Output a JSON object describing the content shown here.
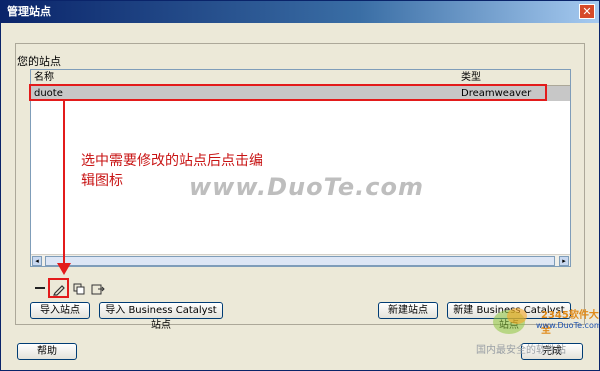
{
  "window": {
    "title": "管理站点",
    "close_glyph": "✕"
  },
  "group": {
    "title": "您的站点"
  },
  "list": {
    "headers": {
      "name": "名称",
      "type": "类型"
    },
    "rows": [
      {
        "name": "duote",
        "type": "Dreamweaver"
      }
    ]
  },
  "toolbar": {
    "remove_icon": "minus-icon",
    "edit_icon": "pencil-icon",
    "duplicate_icon": "duplicate-icon",
    "export_icon": "export-icon"
  },
  "annotation": {
    "text": "选中需要修改的站点后点击编辑图标"
  },
  "watermark": {
    "text": "www.DuoTe.com"
  },
  "buttons": {
    "import_site": "导入站点",
    "import_bc": "导入 Business Catalyst 站点",
    "new_site": "新建站点",
    "new_bc": "新建 Business Catalyst 站点",
    "help": "帮助",
    "done": "完成"
  },
  "logo": {
    "line1": "2345软件大全",
    "line2": "www.DuoTe.com",
    "line3": "国内最安全的软件站"
  },
  "colors": {
    "highlight": "#e31b1b",
    "annotation": "#c81414",
    "titlebar": "#0a246a"
  }
}
